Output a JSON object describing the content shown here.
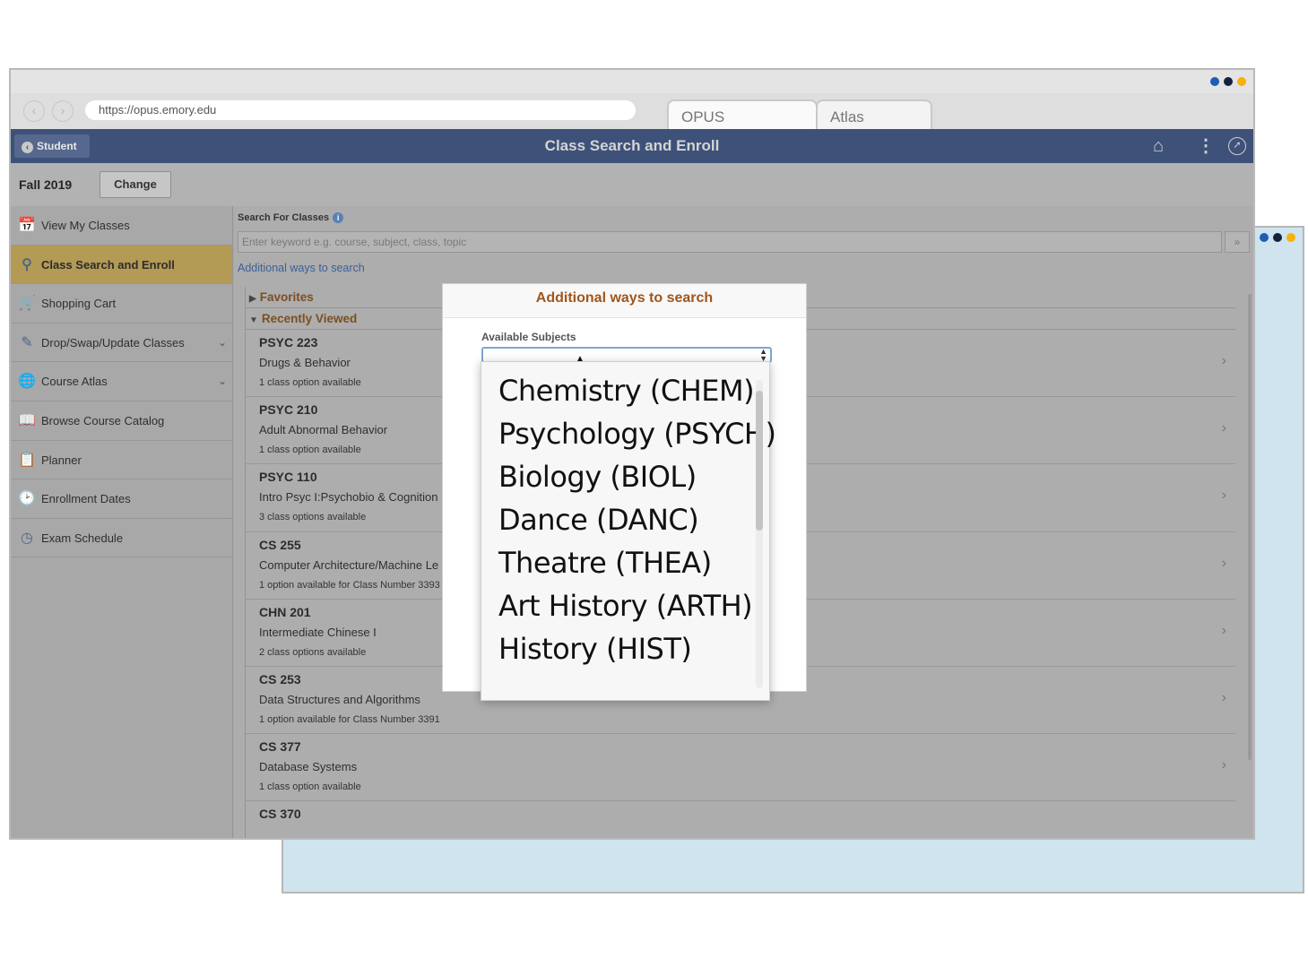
{
  "browser": {
    "url": "https://opus.emory.edu",
    "tabs": [
      "OPUS",
      "Atlas"
    ],
    "window_dots": [
      "#1a5fb4",
      "#14213d",
      "#f5b20a"
    ]
  },
  "header": {
    "back_label": "Student",
    "title": "Class Search and Enroll"
  },
  "term": {
    "label": "Fall 2019",
    "change_label": "Change"
  },
  "sidebar": {
    "items": [
      {
        "label": "View My Classes",
        "icon": "calendar-icon"
      },
      {
        "label": "Class Search and Enroll",
        "icon": "search-icon",
        "active": true
      },
      {
        "label": "Shopping Cart",
        "icon": "cart-icon"
      },
      {
        "label": "Drop/Swap/Update Classes",
        "icon": "edit-icon",
        "caret": true
      },
      {
        "label": "Course Atlas",
        "icon": "globe-icon",
        "caret": true
      },
      {
        "label": "Browse Course Catalog",
        "icon": "catalog-icon"
      },
      {
        "label": "Planner",
        "icon": "planner-icon"
      },
      {
        "label": "Enrollment Dates",
        "icon": "dates-icon"
      },
      {
        "label": "Exam Schedule",
        "icon": "clock-icon"
      }
    ]
  },
  "search": {
    "label": "Search For Classes",
    "placeholder": "Enter keyword e.g. course, subject, class, topic",
    "go_label": "»",
    "more_link": "Additional ways to search"
  },
  "groups": {
    "favorites": "Favorites",
    "recently_viewed": "Recently Viewed"
  },
  "courses": [
    {
      "code": "PSYC 223",
      "name": "Drugs & Behavior",
      "options": "1 class option available"
    },
    {
      "code": "PSYC 210",
      "name": "Adult Abnormal Behavior",
      "options": "1 class option available"
    },
    {
      "code": "PSYC 110",
      "name": "Intro Psyc I:Psychobio & Cognition",
      "options": "3 class options available"
    },
    {
      "code": "CS 255",
      "name": "Computer Architecture/Machine Le",
      "options": "1 option available for Class Number 3393"
    },
    {
      "code": "CHN 201",
      "name": "Intermediate Chinese I",
      "options": "2 class options available"
    },
    {
      "code": "CS 253",
      "name": "Data Structures and Algorithms",
      "options": "1 option available for Class Number 3391"
    },
    {
      "code": "CS 377",
      "name": "Database Systems",
      "options": "1 class option available"
    },
    {
      "code": "CS 370",
      "name": "",
      "options": ""
    }
  ],
  "modal": {
    "title": "Additional ways to search",
    "subjects_label": "Available Subjects",
    "subjects": [
      "Chemistry (CHEM)",
      "Psychology (PSYCH)",
      "Biology (BIOL)",
      "Dance (DANC)",
      "Theatre (THEA)",
      "Art History (ARTH)",
      "History (HIST)"
    ]
  }
}
